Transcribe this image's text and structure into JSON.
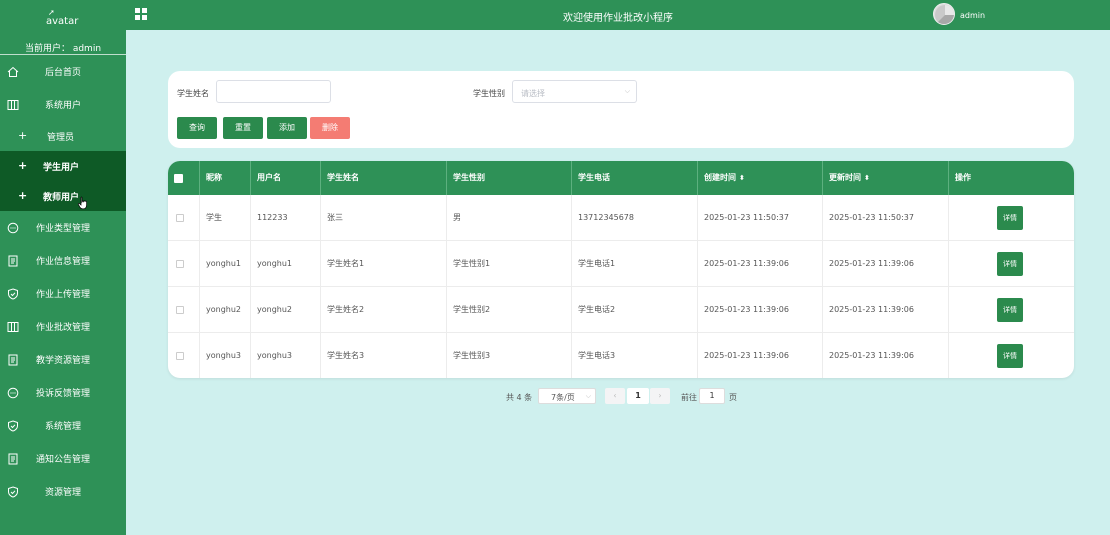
{
  "sidebar": {
    "logo_text": "avatar",
    "current_user": "当前用户： admin",
    "items": [
      {
        "label": "后台首页",
        "icon": "home-icon"
      },
      {
        "label": "系统用户",
        "icon": "columns-icon"
      },
      {
        "label": "管理员",
        "sub": true
      },
      {
        "label": "学生用户",
        "sub": true,
        "active": true
      },
      {
        "label": "教师用户",
        "sub": true,
        "hovered": true
      },
      {
        "label": "作业类型管理",
        "icon": "chat-icon"
      },
      {
        "label": "作业信息管理",
        "icon": "doc-icon"
      },
      {
        "label": "作业上传管理",
        "icon": "shield-icon"
      },
      {
        "label": "作业批改管理",
        "icon": "columns-icon"
      },
      {
        "label": "教学资源管理",
        "icon": "doc-icon"
      },
      {
        "label": "投诉反馈管理",
        "icon": "chat-icon"
      },
      {
        "label": "系统管理",
        "icon": "shield-icon"
      },
      {
        "label": "通知公告管理",
        "icon": "doc-icon"
      },
      {
        "label": "资源管理",
        "icon": "shield-icon"
      }
    ]
  },
  "topbar": {
    "title": "欢迎使用作业批改小程序",
    "user": "admin"
  },
  "search": {
    "name_label": "学生姓名",
    "name_value": "",
    "gender_label": "学生性别",
    "gender_placeholder": "请选择",
    "buttons": {
      "query": "查询",
      "reset": "重置",
      "add": "添加",
      "delete": "删除"
    }
  },
  "table": {
    "headers": [
      "昵称",
      "用户名",
      "学生姓名",
      "学生性别",
      "学生电话",
      "创建时间",
      "更新时间",
      "操作"
    ],
    "rows": [
      [
        "学生",
        "112233",
        "张三",
        "男",
        "13712345678",
        "2025-01-23 11:50:37",
        "2025-01-23 11:50:37"
      ],
      [
        "yonghu1",
        "yonghu1",
        "学生姓名1",
        "学生性别1",
        "学生电话1",
        "2025-01-23 11:39:06",
        "2025-01-23 11:39:06"
      ],
      [
        "yonghu2",
        "yonghu2",
        "学生姓名2",
        "学生性别2",
        "学生电话2",
        "2025-01-23 11:39:06",
        "2025-01-23 11:39:06"
      ],
      [
        "yonghu3",
        "yonghu3",
        "学生姓名3",
        "学生性别3",
        "学生电话3",
        "2025-01-23 11:39:06",
        "2025-01-23 11:39:06"
      ]
    ],
    "detail_label": "详情"
  },
  "pagination": {
    "total": "共 4 条",
    "page_size": "7条/页",
    "current_page": "1",
    "goto_label": "前往",
    "goto_value": "1",
    "goto_unit": "页"
  },
  "colors": {
    "sidebar_bg": "#2e9157",
    "active_bg": "#0e5a26",
    "page_bg": "#cff0ee",
    "delete_btn": "#f47c73"
  }
}
